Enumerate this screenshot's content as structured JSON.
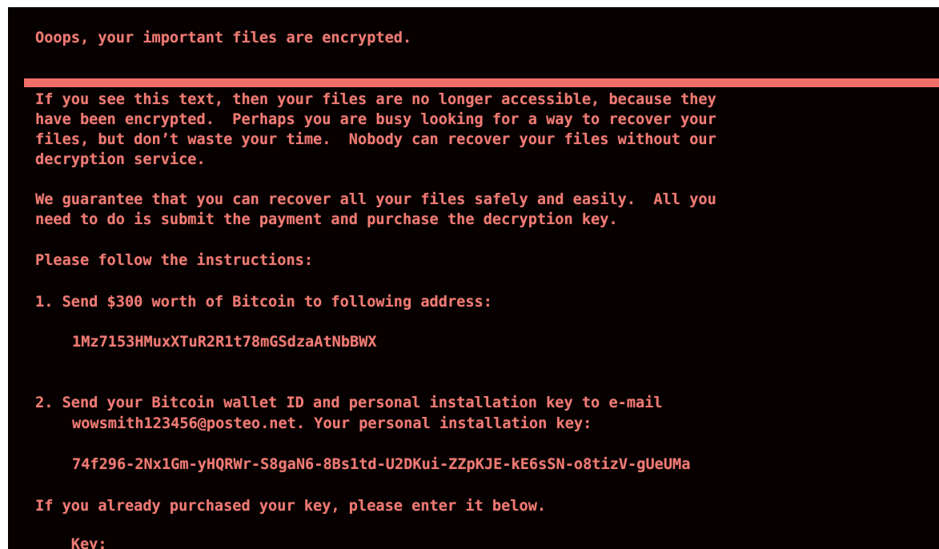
{
  "title": "Ooops, your important files are encrypted.",
  "paragraphs": {
    "intro": [
      "If you see this text, then your files are no longer accessible, because they",
      "have been encrypted.  Perhaps you are busy looking for a way to recover your",
      "files, but don’t waste your time.  Nobody can recover your files without our",
      "decryption service."
    ],
    "guarantee": [
      "We guarantee that you can recover all your files safely and easily.  All you",
      "need to do is submit the payment and purchase the decryption key."
    ],
    "instructions": "Please follow the instructions:"
  },
  "step1": {
    "text": "1. Send $300 worth of Bitcoin to following address:",
    "address": "1Mz7153HMuxXTuR2R1t78mGSdzaAtNbBWX"
  },
  "step2": {
    "line1": "2. Send your Bitcoin wallet ID and personal installation key to e-mail",
    "line2": "wowsmith123456@posteo.net. Your personal installation key:",
    "installation_key": "74f296-2Nx1Gm-yHQRWr-S8gaN6-8Bs1td-U2DKui-ZZpKJE-kE6sSN-o8tizV-gUeUMa"
  },
  "footer": {
    "notice": "If you already purchased your key, please enter it below.",
    "key_label": "Key: "
  },
  "colors": {
    "background": "#060000",
    "text": "#ee7a73",
    "rule": "#f06f69"
  }
}
